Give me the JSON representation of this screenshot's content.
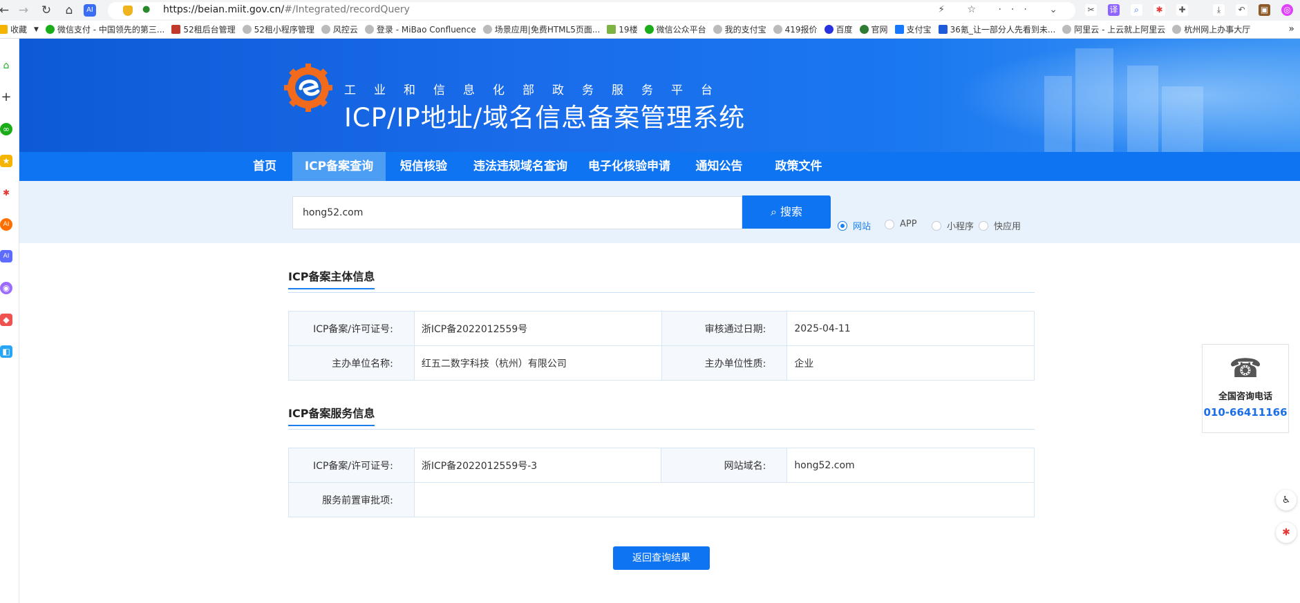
{
  "browser": {
    "url_host": "https://beian.miit.gov.cn/",
    "url_path": "#/Integrated/recordQuery",
    "back": "←",
    "forward": "→",
    "reload": "↻",
    "home": "⌂",
    "ai_badge": "AI",
    "tools": "⚡ ☆ ··· ⌄",
    "bookmarks": [
      {
        "label": "收藏",
        "color": "#f5b400"
      },
      {
        "label": "微信支付 - 中国领先的第三...",
        "color": "#1aad19"
      },
      {
        "label": "52租后台管理",
        "color": "#c0392b"
      },
      {
        "label": "52租小程序管理",
        "color": "#999999"
      },
      {
        "label": "风控云",
        "color": "#999999"
      },
      {
        "label": "登录 - MiBao Confluence",
        "color": "#999999"
      },
      {
        "label": "场景应用|免费HTML5页面...",
        "color": "#999999"
      },
      {
        "label": "19楼",
        "color": "#7cb342"
      },
      {
        "label": "微信公众平台",
        "color": "#1aad19"
      },
      {
        "label": "我的支付宝",
        "color": "#999999"
      },
      {
        "label": "419报价",
        "color": "#999999"
      },
      {
        "label": "百度",
        "color": "#2932e1"
      },
      {
        "label": "官网",
        "color": "#2e7d32"
      },
      {
        "label": "支付宝",
        "color": "#1677ff"
      },
      {
        "label": "36氪_让一部分人先看到未...",
        "color": "#1e5bd8"
      },
      {
        "label": "阿里云 - 上云就上阿里云",
        "color": "#999999"
      },
      {
        "label": "杭州网上办事大厅",
        "color": "#999999"
      }
    ],
    "more": "»"
  },
  "header": {
    "ministry": "工业和信息化部政务服务平台",
    "system_name": "ICP/IP地址/域名信息备案管理系统"
  },
  "nav": {
    "items": [
      {
        "label": "首页"
      },
      {
        "label": "ICP备案查询"
      },
      {
        "label": "短信核验"
      },
      {
        "label": "违法违规域名查询"
      },
      {
        "label": "电子化核验申请"
      },
      {
        "label": "通知公告"
      },
      {
        "label": "政策文件"
      }
    ],
    "active_index": 1
  },
  "search": {
    "value": "hong52.com",
    "button_label": "搜索",
    "search_icon": "⌕",
    "types": [
      {
        "label": "网站",
        "selected": true
      },
      {
        "label": "APP",
        "selected": false
      },
      {
        "label": "小程序",
        "selected": false
      },
      {
        "label": "快应用",
        "selected": false
      }
    ]
  },
  "subject_info": {
    "title": "ICP备案主体信息",
    "license_label": "ICP备案/许可证号:",
    "license_value": "浙ICP备2022012559号",
    "approve_date_label": "审核通过日期:",
    "approve_date_value": "2025-04-11",
    "org_name_label": "主办单位名称:",
    "org_name_value": "红五二数字科技（杭州）有限公司",
    "org_type_label": "主办单位性质:",
    "org_type_value": "企业"
  },
  "service_info": {
    "title": "ICP备案服务信息",
    "license_label": "ICP备案/许可证号:",
    "license_value": "浙ICP备2022012559号-3",
    "domain_label": "网站域名:",
    "domain_value": "hong52.com",
    "pre_approval_label": "服务前置审批项:",
    "pre_approval_value": ""
  },
  "back_button": "返回查询结果",
  "hotline": {
    "icon": "☎",
    "title": "全国咨询电话",
    "number": "010-66411166"
  },
  "accent_color": "#0e74f1"
}
